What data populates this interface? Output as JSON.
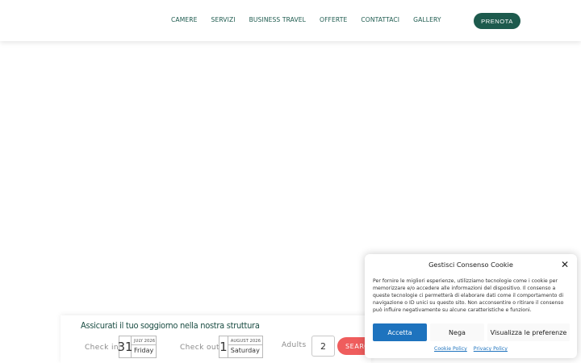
{
  "header": {
    "nav": [
      "CAMERE",
      "SERVIZI",
      "BUSINESS TRAVEL",
      "OFFERTE",
      "CONTATTACI",
      "GALLERY"
    ],
    "cta_label": "PRENOTA"
  },
  "booking": {
    "title": "Assicurati il tuo soggiorno nella nostra struttura",
    "checkin": {
      "label": "Check in",
      "day": "31",
      "month_year": "JULY 2026",
      "weekday": "Friday"
    },
    "checkout": {
      "label": "Check out",
      "day": "1",
      "month_year": "AUGUST 2026",
      "weekday": "Saturday"
    },
    "adults": {
      "label": "Adults",
      "value": "2"
    },
    "search_label": "SEARCH"
  },
  "cookie": {
    "title": "Gestisci Consenso Cookie",
    "text": "Per fornire le migliori esperienze, utilizziamo tecnologie come i cookie per memorizzare e/o accedere alle informazioni del dispositivo. Il consenso a queste tecnologie ci permetterà di elaborare dati come il comportamento di navigazione o ID unici su questo sito. Non acconsentire o ritirare il consenso può influire negativamente su alcune caratteristiche e funzioni.",
    "accept_label": "Accetta",
    "deny_label": "Nega",
    "prefs_label": "Visualizza le preferenze",
    "links": [
      "Cookie Policy",
      "Privacy Policy"
    ]
  },
  "colors": {
    "brand": "#1d5a4d",
    "accent": "#1e73be",
    "search": "#ef5d5d"
  }
}
